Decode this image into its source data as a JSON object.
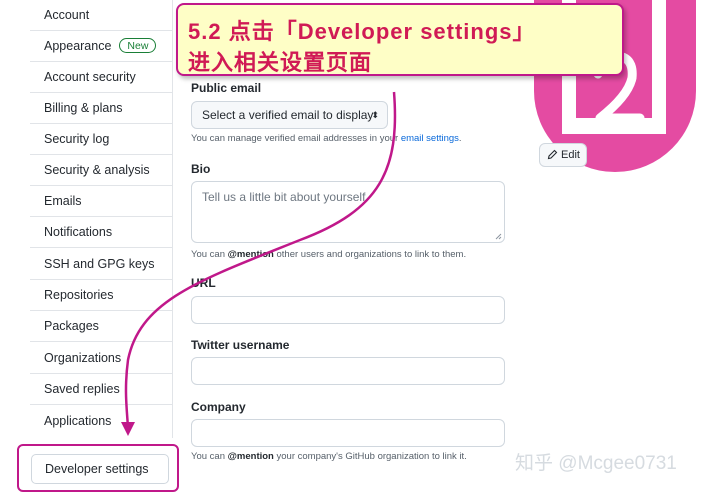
{
  "sidebar": {
    "items": [
      {
        "label": "Account"
      },
      {
        "label": "Appearance",
        "badge": "New"
      },
      {
        "label": "Account security"
      },
      {
        "label": "Billing & plans"
      },
      {
        "label": "Security log"
      },
      {
        "label": "Security & analysis"
      },
      {
        "label": "Emails"
      },
      {
        "label": "Notifications"
      },
      {
        "label": "SSH and GPG keys"
      },
      {
        "label": "Repositories"
      },
      {
        "label": "Packages"
      },
      {
        "label": "Organizations"
      },
      {
        "label": "Saved replies"
      },
      {
        "label": "Applications"
      }
    ],
    "developer_settings": "Developer settings"
  },
  "form": {
    "public_email": {
      "label": "Public email",
      "select_value": "Select a verified email to display",
      "note_prefix": "You can manage verified email addresses in your",
      "note_link": "email settings",
      "note_suffix": "."
    },
    "bio": {
      "label": "Bio",
      "placeholder": "Tell us a little bit about yourself",
      "note_prefix": "You can",
      "note_mention": "@mention",
      "note_suffix": "other users and organizations to link to them."
    },
    "url": {
      "label": "URL"
    },
    "twitter": {
      "label": "Twitter username"
    },
    "company": {
      "label": "Company",
      "note_prefix": "You can",
      "note_mention": "@mention",
      "note_suffix": "your company's GitHub organization to link it."
    }
  },
  "avatar": {
    "edit_label": "Edit",
    "color": "#e44ba2"
  },
  "callout": {
    "line1": "5.2 点击「Developer settings」",
    "line2": "进入相关设置页面",
    "border_color": "#c0188a",
    "text_color": "#d01a55",
    "background": "#fefec6"
  },
  "watermark": "知乎 @Mcgee0731"
}
